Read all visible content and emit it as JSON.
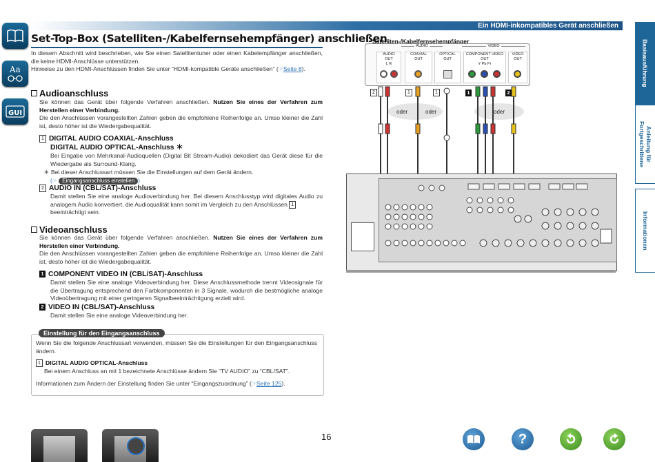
{
  "header": {
    "section_label": "Ein HDMI-inkompatibles Gerät anschließen"
  },
  "title": "Set-Top-Box (Satelliten-/Kabelfernsehempfänger) anschließen",
  "intro": {
    "line1": "In diesem Abschnitt wird beschrieben, wie Sie einen Satellitentuner oder einen Kabelempfänger anschließen, die keine HDMI-Anschlüsse unterstützen.",
    "line2": "Hinweise zu den HDMI-Anschlüssen finden Sie unter “HDMI-kompatible Geräte anschließen” (",
    "link": "Seite 8",
    "line2_end": ")."
  },
  "audio": {
    "heading": "Audioanschluss",
    "p1_normal": "Sie können das Gerät über folgende Verfahren anschließen. ",
    "p1_bold": "Nutzen Sie eines der Verfahren zum Herstellen einer Verbindung.",
    "p2": "Die den Anschlüssen vorangestellten Zahlen geben die empfohlene Reihenfolge an. Umso kleiner die Zahl ist, desto höher ist die Wiedergabequalität.",
    "item1_num": "1",
    "item1_title_a": "DIGITAL AUDIO COAXIAL-Anschluss",
    "item1_title_b": "DIGITAL AUDIO OPTICAL-Anschluss",
    "item1_star": "＊",
    "item1_text": "Bei Eingabe von Mehrkanal-Audioquellen (Digital Bit Stream-Audio) dekodiert das Gerät diese für die Wiedergabe als Surround-Klang.",
    "item1_note_star": "＊",
    "item1_note": "Bei dieser Anschlussart müssen Sie die Einstellungen auf dem Gerät ändern.",
    "item1_note_pill": "Eingangsanschluss einstellen",
    "item2_num": "2",
    "item2_title": "AUDIO IN (CBL/SAT)-Anschluss",
    "item2_text": "Damit stellen Sie eine analoge Audioverbindung her. Bei diesem Anschlusstyp wird digitales Audio zu analogem Audio konvertiert, die Audioqualität kann somit im Vergleich zu den Anschlüssen",
    "item2_text_end": "beeinträchtigt sein."
  },
  "video": {
    "heading": "Videoanschluss",
    "p1_normal": "Sie können das Gerät über folgende Verfahren anschließen. ",
    "p1_bold": "Nutzen Sie eines der Verfahren zum Herstellen einer Verbindung.",
    "p2": "Die den Anschlüssen vorangestellten Zahlen geben die empfohlene Reihenfolge an. Umso kleiner die Zahl ist, desto höher ist die Wiedergabequalität.",
    "item1_num": "1",
    "item1_title": "COMPONENT VIDEO IN (CBL/SAT)-Anschluss",
    "item1_text": "Damit stellen Sie eine analoge Videoverbindung her. Diese Anschlussmethode trennt Videosignale für die Übertragung entsprechend den Farbkomponenten in 3 Signale, wodurch die bestmögliche analoge Videoübertragung mit einer geringeren Signalbeeinträchtigung erzielt wird.",
    "item2_num": "2",
    "item2_title": "VIDEO IN (CBL/SAT)-Anschluss",
    "item2_text": "Damit stellen Sie eine analoge Videoverbindung her."
  },
  "infobox": {
    "label": "Einstellung für den Eingangsanschluss",
    "p1": "Wenn Sie die folgende Anschlussart verwenden, müssen Sie die Einstellungen für den Eingangsanschluss ändern.",
    "item_num": "1",
    "item_title": "DIGITAL AUDIO OPTICAL-Anschluss",
    "item_text": "Bei einem Anschluss an mit 1 bezeichnete Anschlüsse ändern Sie “TV AUDIO” zu “CBL/SAT”.",
    "p2": "Informationen zum Ändern der Einstellung finden Sie unter “Eingangszuordnung” (",
    "link": "Seite 125",
    "p2_end": ")."
  },
  "diagram": {
    "device_title": "Satelliten-/Kabelfernsehempfänger",
    "audio_label": "AUDIO",
    "video_label": "VIDEO",
    "ports": [
      {
        "name": "AUDIO",
        "sub": "OUT",
        "lr": "L    R"
      },
      {
        "name": "COAXIAL",
        "sub": "OUT"
      },
      {
        "name": "OPTICAL",
        "sub": "OUT"
      },
      {
        "name": "COMPONENT VIDEO",
        "sub": "OUT",
        "lr": "Y   Pb   Pr"
      },
      {
        "name": "VIDEO",
        "sub": "OUT"
      }
    ],
    "cable_nums": [
      "2",
      "1",
      "1",
      "1",
      "2"
    ],
    "oder": [
      "oder",
      "oder",
      "oder"
    ]
  },
  "right_tabs": [
    "Basisausführung",
    "Anleitung für Fortgeschrittene",
    "Informationen"
  ],
  "page_number": "16",
  "colors": {
    "brand_blue": "#1f6698",
    "accent": "#2e6fa5"
  }
}
